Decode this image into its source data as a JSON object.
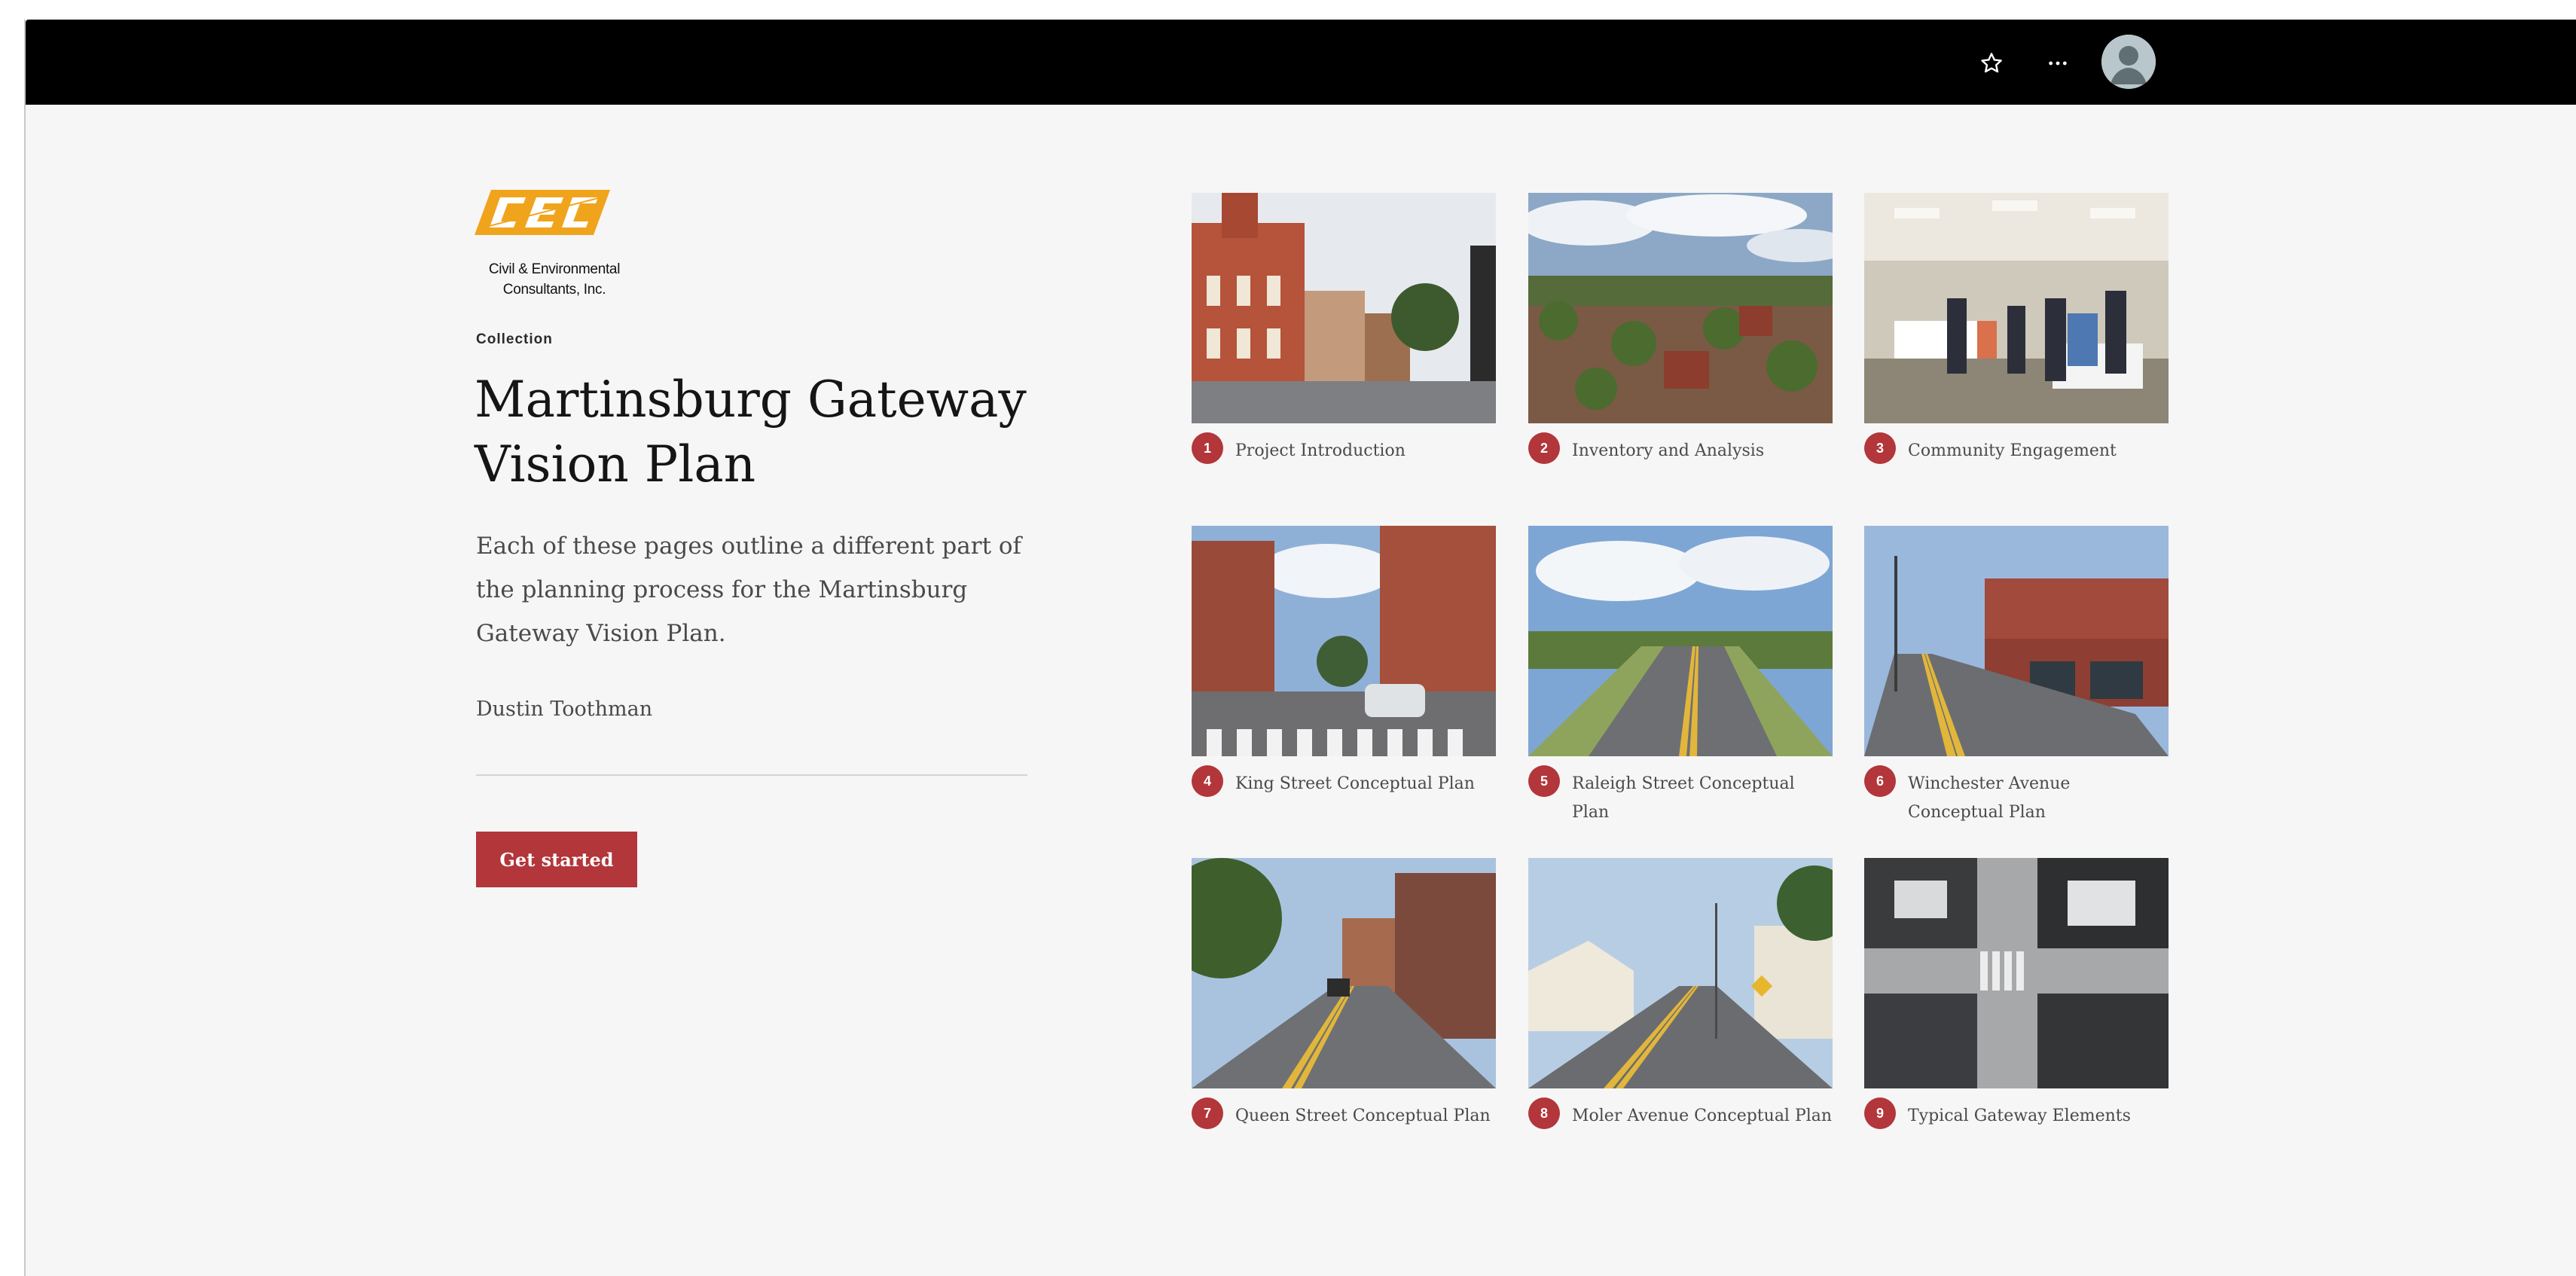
{
  "header": {
    "icons": [
      "star-icon",
      "more-options-icon",
      "user-avatar-icon"
    ]
  },
  "logo": {
    "mark_text": "CEC",
    "company_line1": "Civil & Environmental",
    "company_line2": "Consultants, Inc.",
    "brand_color": "#f0a41c"
  },
  "collection": {
    "label": "Collection",
    "title": "Martinsburg Gateway Vision Plan",
    "description": "Each of these pages outline a different part of the planning process for the Martinsburg Gateway Vision Plan.",
    "author": "Dustin Toothman",
    "cta_label": "Get started",
    "accent_color": "#b2363a"
  },
  "cards": [
    {
      "number": "1",
      "label": "Project Introduction"
    },
    {
      "number": "2",
      "label": "Inventory and Analysis"
    },
    {
      "number": "3",
      "label": "Community Engagement"
    },
    {
      "number": "4",
      "label": "King Street Conceptual Plan"
    },
    {
      "number": "5",
      "label": "Raleigh Street Conceptual Plan"
    },
    {
      "number": "6",
      "label": "Winchester Avenue Conceptual Plan"
    },
    {
      "number": "7",
      "label": "Queen Street Conceptual Plan"
    },
    {
      "number": "8",
      "label": "Moler Avenue Conceptual Plan"
    },
    {
      "number": "9",
      "label": "Typical Gateway Elements"
    }
  ]
}
